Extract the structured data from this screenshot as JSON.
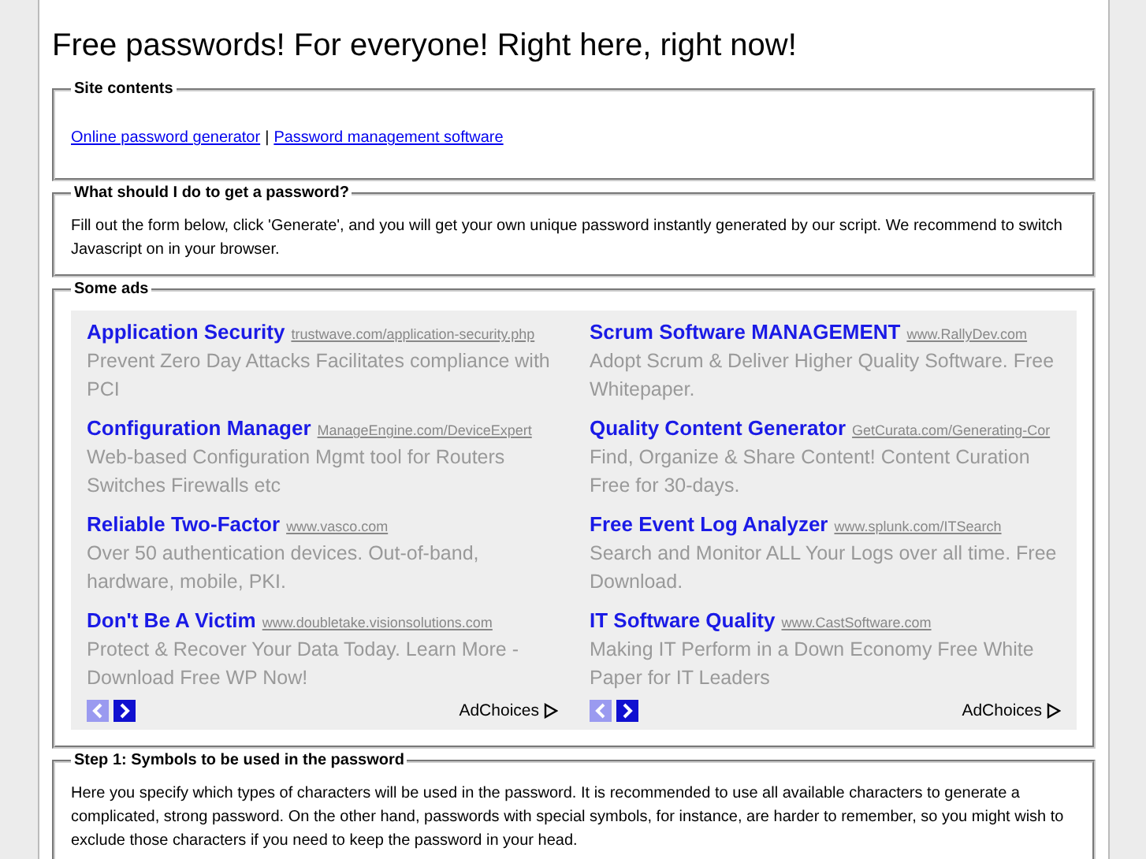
{
  "title": "Free passwords! For everyone! Right here, right now!",
  "site_contents": {
    "legend": "Site contents",
    "links": [
      "Online password generator",
      "Password management software"
    ],
    "separator": "|"
  },
  "how_to": {
    "legend": "What should I do to get a password?",
    "text": "Fill out the form below, click 'Generate', and you will get your own unique password instantly generated by our script. We recommend to switch Javascript on in your browser."
  },
  "ads": {
    "legend": "Some ads",
    "blocks": [
      {
        "ads": [
          {
            "title": "Application Security",
            "url": "trustwave.com/application-security.php",
            "text": "Prevent Zero Day Attacks Facilitates compliance with PCI"
          },
          {
            "title": "Configuration Manager",
            "url": "ManageEngine.com/DeviceExpert",
            "text": "Web-based Configuration Mgmt tool for Routers Switches Firewalls etc"
          },
          {
            "title": "Reliable Two-Factor",
            "url": "www.vasco.com",
            "text": "Over 50 authentication devices. Out-of-band, hardware, mobile, PKI."
          },
          {
            "title": "Don't Be A Victim",
            "url": "www.doubletake.visionsolutions.com",
            "text": "Protect & Recover Your Data Today. Learn More - Download Free WP Now!"
          }
        ],
        "prev_disabled": true,
        "next_disabled": false,
        "adchoices": "AdChoices"
      },
      {
        "ads": [
          {
            "title": "Scrum Software MANAGEMENT",
            "url": "www.RallyDev.com",
            "text": "Adopt Scrum & Deliver Higher Quality Software. Free Whitepaper."
          },
          {
            "title": "Quality Content Generator",
            "url": "GetCurata.com/Generating-Cor",
            "text": "Find, Organize & Share Content! Content Curation Free for 30-days."
          },
          {
            "title": "Free Event Log Analyzer",
            "url": "www.splunk.com/ITSearch",
            "text": "Search and Monitor ALL Your Logs over all time. Free Download."
          },
          {
            "title": "IT Software Quality",
            "url": "www.CastSoftware.com",
            "text": "Making IT Perform in a Down Economy Free White Paper for IT Leaders"
          }
        ],
        "prev_disabled": true,
        "next_disabled": false,
        "adchoices": "AdChoices"
      }
    ]
  },
  "step1": {
    "legend": "Step 1: Symbols to be used in the password",
    "text": "Here you specify which types of characters will be used in the password. It is recommended to use all available characters to generate a complicated, strong password. On the other hand, passwords with special symbols, for instance, are harder to remember, so you might wish to exclude those characters if you need to keep the password in your head."
  }
}
